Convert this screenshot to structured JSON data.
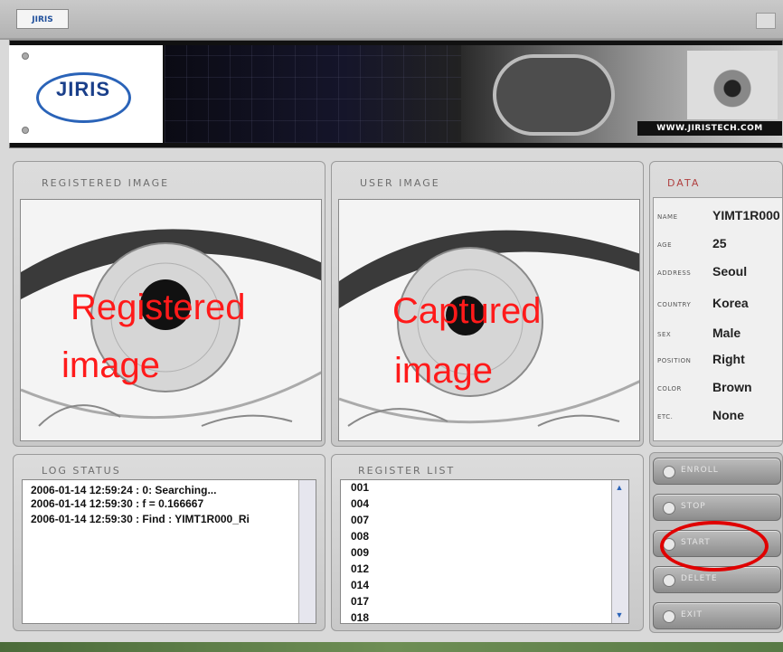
{
  "window": {
    "title_logo": "JIRIS"
  },
  "header": {
    "logo_text": "JIRIS",
    "url": "WWW.JIRISTECH.COM"
  },
  "panels": {
    "registered": {
      "title": "REGISTERED IMAGE",
      "overlay_line1": "Registered",
      "overlay_line2": "image"
    },
    "user": {
      "title": "USER IMAGE",
      "overlay_line1": "Captured",
      "overlay_line2": "image"
    }
  },
  "data_panel": {
    "title": "DATA",
    "fields": [
      {
        "label": "NAME",
        "value": "YIMT1R000"
      },
      {
        "label": "AGE",
        "value": "25"
      },
      {
        "label": "ADDRESS",
        "value": "Seoul"
      },
      {
        "label": "COUNTRY",
        "value": "Korea"
      },
      {
        "label": "SEX",
        "value": "Male"
      },
      {
        "label": "POSITION",
        "value": "Right"
      },
      {
        "label": "COLOR",
        "value": "Brown"
      },
      {
        "label": "ETC.",
        "value": "None"
      }
    ]
  },
  "log_status": {
    "title": "LOG STATUS",
    "lines": [
      "2006-01-14 12:59:24 : 0: Searching...",
      "2006-01-14 12:59:30 : f = 0.166667",
      "2006-01-14 12:59:30 : Find : YIMT1R000_Ri"
    ]
  },
  "register_list": {
    "title": "REGISTER LIST",
    "items": [
      "001",
      "004",
      "007",
      "008",
      "009",
      "012",
      "014",
      "017",
      "018"
    ]
  },
  "buttons": {
    "enroll": "ENROLL",
    "stop": "STOP",
    "start": "START",
    "delete": "DELETE",
    "exit": "EXIT"
  },
  "colors": {
    "annotation": "#e00000",
    "logo_blue": "#1f4f9b"
  }
}
